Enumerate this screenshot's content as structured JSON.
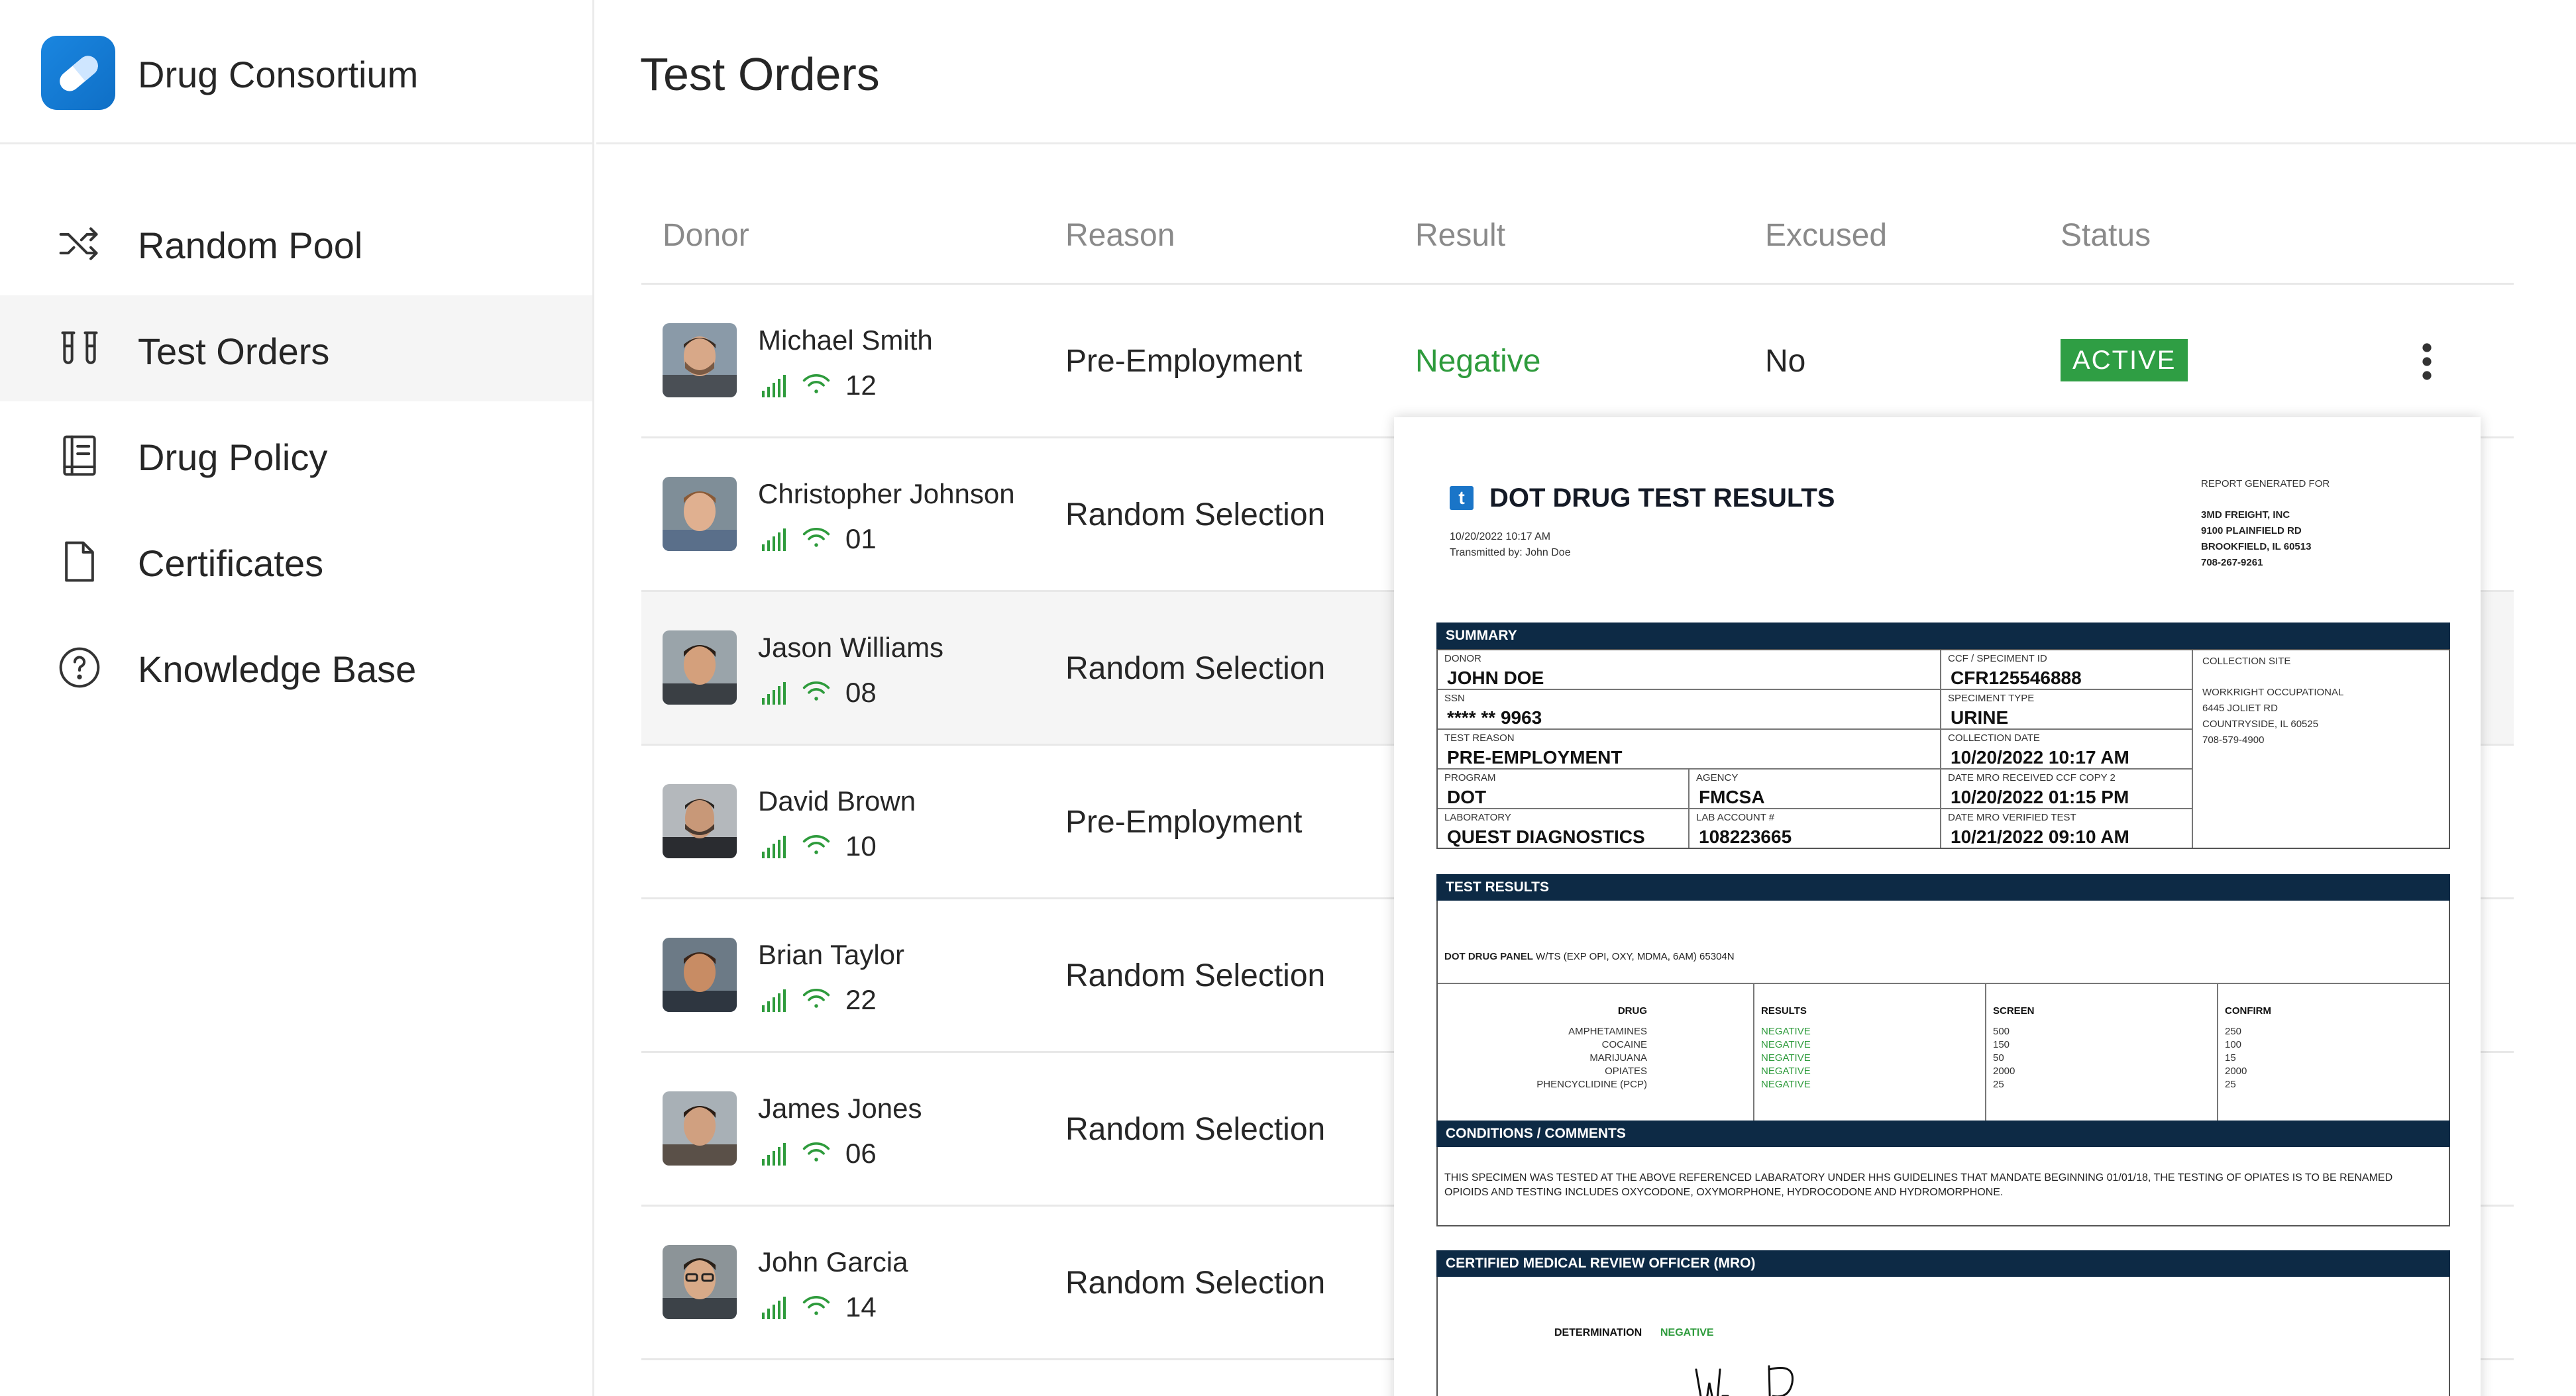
{
  "brand": {
    "name": "Drug Consortium"
  },
  "sidebar": {
    "items": [
      {
        "label": "Random Pool",
        "icon": "shuffle-icon"
      },
      {
        "label": "Test Orders",
        "icon": "test-tubes-icon",
        "active": true
      },
      {
        "label": "Drug Policy",
        "icon": "book-icon"
      },
      {
        "label": "Certificates",
        "icon": "document-icon"
      },
      {
        "label": "Knowledge Base",
        "icon": "help-circle-icon"
      }
    ]
  },
  "header": {
    "title": "Test Orders"
  },
  "table": {
    "columns": [
      "Donor",
      "Reason",
      "Result",
      "Excused",
      "Status"
    ],
    "rows": [
      {
        "name": "Michael Smith",
        "count": "12",
        "reason": "Pre-Employment",
        "result": "Negative",
        "excused": "No",
        "status": "ACTIVE"
      },
      {
        "name": "Christopher Johnson",
        "count": "01",
        "reason": "Random Selection"
      },
      {
        "name": "Jason Williams",
        "count": "08",
        "reason": "Random Selection"
      },
      {
        "name": "David Brown",
        "count": "10",
        "reason": "Pre-Employment"
      },
      {
        "name": "Brian Taylor",
        "count": "22",
        "reason": "Random Selection"
      },
      {
        "name": "James Jones",
        "count": "06",
        "reason": "Random Selection"
      },
      {
        "name": "John Garcia",
        "count": "14",
        "reason": "Random Selection"
      }
    ]
  },
  "report": {
    "logo_letter": "t",
    "title": "DOT DRUG TEST RESULTS",
    "date": "10/20/2022 10:17 AM",
    "transmitted": "Transmitted by: John Doe",
    "generated_for_label": "REPORT GENERATED FOR",
    "generated_for": [
      "3MD FREIGHT, INC",
      "9100 PLAINFIELD RD",
      "BROOKFIELD, IL 60513",
      "708-267-9261"
    ],
    "summary": {
      "heading": "SUMMARY",
      "donor_label": "DONOR",
      "donor": "JOHN DOE",
      "ccf_label": "CCF / SPECIMENT ID",
      "ccf": "CFR125546888",
      "ssn_label": "SSN",
      "ssn": "**** ** 9963",
      "specimen_label": "SPECIMENT TYPE",
      "specimen": "URINE",
      "reason_label": "TEST REASON",
      "reason": "PRE-EMPLOYMENT",
      "collection_label": "COLLECTION DATE",
      "collection": "10/20/2022 10:17 AM",
      "program_label": "PROGRAM",
      "program": "DOT",
      "agency_label": "AGENCY",
      "agency": "FMCSA",
      "received_label": "DATE MRO RECEIVED CCF COPY 2",
      "received": "10/20/2022 01:15 PM",
      "lab_label": "LABORATORY",
      "lab": "QUEST DIAGNOSTICS",
      "account_label": "LAB ACCOUNT #",
      "account": "108223665",
      "verified_label": "DATE MRO VERIFIED TEST",
      "verified": "10/21/2022 09:10 AM",
      "site_label": "COLLECTION SITE",
      "site": [
        "WORKRIGHT OCCUPATIONAL",
        "6445 JOLIET RD",
        "COUNTRYSIDE, IL 60525",
        "708-579-4900"
      ]
    },
    "results": {
      "heading": "TEST RESULTS",
      "panel_bold": "DOT DRUG PANEL",
      "panel_rest": " W/TS (EXP OPI, OXY, MDMA, 6AM) 65304N",
      "headers": {
        "drug": "DRUG",
        "results": "RESULTS",
        "screen": "SCREEN",
        "confirm": "CONFIRM"
      },
      "drugs": [
        "AMPHETAMINES",
        "COCAINE",
        "MARIJUANA",
        "OPIATES",
        "PHENCYCLIDINE (PCP)"
      ],
      "results_vals": [
        "NEGATIVE",
        "NEGATIVE",
        "NEGATIVE",
        "NEGATIVE",
        "NEGATIVE"
      ],
      "screen": [
        "500",
        "150",
        "50",
        "2000",
        "25"
      ],
      "confirm": [
        "250",
        "100",
        "15",
        "2000",
        "25"
      ]
    },
    "conditions": {
      "heading": "CONDITIONS / COMMENTS",
      "text": "THIS SPECIMEN WAS TESTED AT THE ABOVE REFERENCED LABARATORY UNDER HHS GUIDELINES THAT MANDATE BEGINNING 01/01/18, THE TESTING OF OPIATES IS TO BE RENAMED OPIOIDS AND TESTING INCLUDES OXYCODONE, OXYMORPHONE, HYDROCODONE AND HYDROMORPHONE."
    },
    "mro": {
      "heading": "CERTIFIED MEDICAL REVIEW OFFICER (MRO)",
      "determination_label": "DETERMINATION",
      "determination": "NEGATIVE"
    }
  },
  "colors": {
    "accent": "#1a86e0",
    "positive": "#2e9b3c",
    "report_bar": "#0d2a45"
  }
}
